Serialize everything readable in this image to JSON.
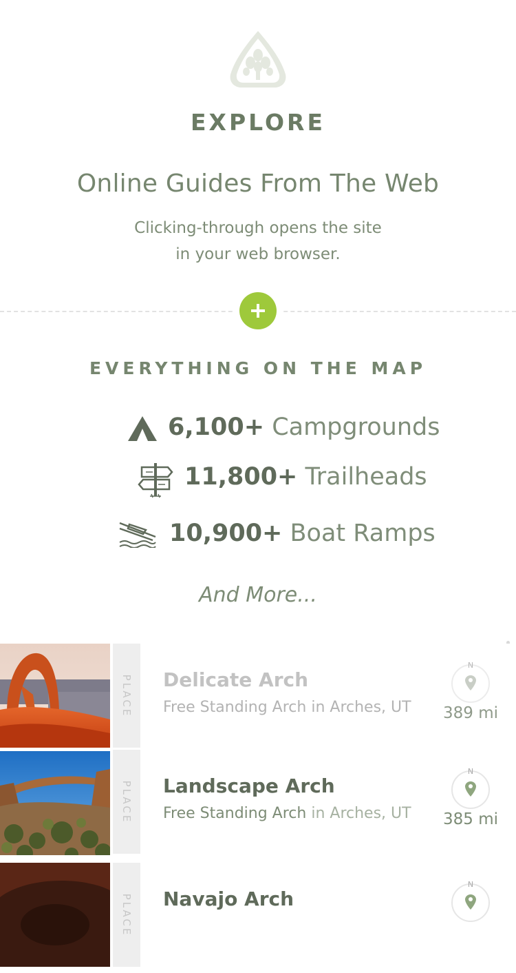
{
  "header": {
    "logo_icon": "tree-leaf-badge-icon",
    "title": "EXPLORE"
  },
  "guides": {
    "title": "Online Guides From The Web",
    "subtitle_line1": "Clicking-through opens the site",
    "subtitle_line2": "in your web browser."
  },
  "expand_button": {
    "icon": "plus-icon"
  },
  "map_section": {
    "title": "EVERYTHING ON THE MAP",
    "stats": [
      {
        "icon": "tent-icon",
        "count": "6,100+",
        "label": "Campgrounds"
      },
      {
        "icon": "trail-sign-icon",
        "count": "11,800+",
        "label": "Trailheads"
      },
      {
        "icon": "boat-ramp-icon",
        "count": "10,900+",
        "label": "Boat Ramps"
      }
    ],
    "more": "And More..."
  },
  "places": [
    {
      "tag": "PLACE",
      "name": "Delicate Arch",
      "type": "Free Standing Arch",
      "connector": "in",
      "location": "Arches, UT",
      "compass_label": "N",
      "distance": "389 mi"
    },
    {
      "tag": "PLACE",
      "name": "Landscape Arch",
      "type": "Free Standing Arch",
      "connector": "in",
      "location": "Arches, UT",
      "compass_label": "N",
      "distance": "385 mi"
    },
    {
      "tag": "PLACE",
      "name": "Navajo Arch",
      "compass_label": "N"
    }
  ],
  "colors": {
    "accent_green": "#9ec93b",
    "primary_text": "#6b7b64",
    "dark_text": "#5f6a5a"
  }
}
